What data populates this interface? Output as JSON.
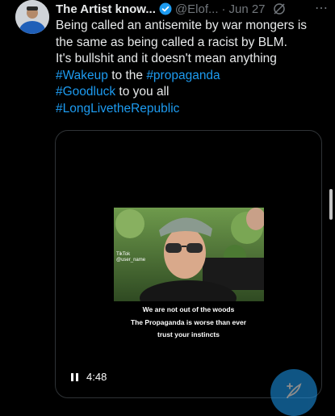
{
  "tweet": {
    "author_name": "The Artist know...",
    "handle": "@Elof...",
    "separator": "·",
    "date": "Jun 27",
    "more_icon": "⋯",
    "lines": [
      [
        "Being called an antisemite by war mongers is"
      ],
      [
        "the same as being called a racist by BLM."
      ],
      [
        "It's bullshit and it doesn't mean anything"
      ]
    ],
    "hashtag_wakeup": "#Wakeup",
    "text_to_the": " to the ",
    "hashtag_propaganda": "#propaganda",
    "hashtag_goodluck": "#Goodluck",
    "text_to_you_all": " to you all",
    "hashtag_longlive": "#LongLivetheRepublic"
  },
  "video": {
    "tiktok_label": "TikTok",
    "tiktok_user": "@user_name",
    "captions": [
      "We are not out of the woods",
      "The Propaganda is worse than ever",
      "trust your instincts"
    ],
    "duration": "4:48"
  },
  "colors": {
    "accent": "#1d9bf0",
    "text": "#e7e9ea",
    "muted": "#71767b"
  }
}
